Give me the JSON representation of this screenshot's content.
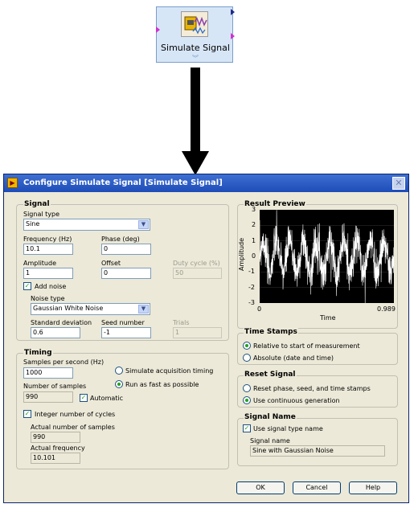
{
  "express_vi": {
    "label": "Simulate Signal",
    "icon": "simulate-signal-icon"
  },
  "dialog": {
    "title": "Configure Simulate Signal [Simulate Signal]",
    "close_icon": "close-icon",
    "signal": {
      "group_title": "Signal",
      "signal_type_label": "Signal type",
      "signal_type_value": "Sine",
      "frequency_label": "Frequency (Hz)",
      "frequency_value": "10.1",
      "phase_label": "Phase (deg)",
      "phase_value": "0",
      "amplitude_label": "Amplitude",
      "amplitude_value": "1",
      "offset_label": "Offset",
      "offset_value": "0",
      "duty_cycle_label": "Duty cycle (%)",
      "duty_cycle_value": "50",
      "add_noise_label": "Add noise",
      "add_noise_checked": true,
      "noise_type_label": "Noise type",
      "noise_type_value": "Gaussian White Noise",
      "std_dev_label": "Standard deviation",
      "std_dev_value": "0.6",
      "seed_label": "Seed number",
      "seed_value": "-1",
      "trials_label": "Trials",
      "trials_value": "1"
    },
    "timing": {
      "group_title": "Timing",
      "sps_label": "Samples per second (Hz)",
      "sps_value": "1000",
      "sim_acq_label": "Simulate acquisition timing",
      "run_fast_label": "Run as fast as possible",
      "selected_mode": "run_fast",
      "num_samples_label": "Number of samples",
      "num_samples_value": "990",
      "automatic_label": "Automatic",
      "automatic_checked": true,
      "integer_cycles_label": "Integer number of cycles",
      "integer_cycles_checked": true,
      "actual_samples_label": "Actual number of samples",
      "actual_samples_value": "990",
      "actual_freq_label": "Actual frequency",
      "actual_freq_value": "10.101"
    },
    "result_preview": {
      "group_title": "Result Preview",
      "ylabel": "Amplitude",
      "xlabel": "Time",
      "y_ticks": [
        "3",
        "2",
        "1",
        "0",
        "-1",
        "-2",
        "-3"
      ],
      "x_ticks": [
        "0",
        "0.989"
      ],
      "ylim": [
        -3,
        3
      ],
      "xlim": [
        0,
        0.989
      ]
    },
    "time_stamps": {
      "group_title": "Time Stamps",
      "relative_label": "Relative to start of measurement",
      "absolute_label": "Absolute (date and time)",
      "selected": "relative"
    },
    "reset_signal": {
      "group_title": "Reset Signal",
      "reset_label": "Reset phase, seed, and time stamps",
      "continuous_label": "Use continuous generation",
      "selected": "continuous"
    },
    "signal_name": {
      "group_title": "Signal Name",
      "use_type_name_label": "Use signal type name",
      "use_type_name_checked": true,
      "name_label": "Signal name",
      "name_value": "Sine with Gaussian Noise"
    },
    "buttons": {
      "ok": "OK",
      "cancel": "Cancel",
      "help": "Help"
    }
  }
}
